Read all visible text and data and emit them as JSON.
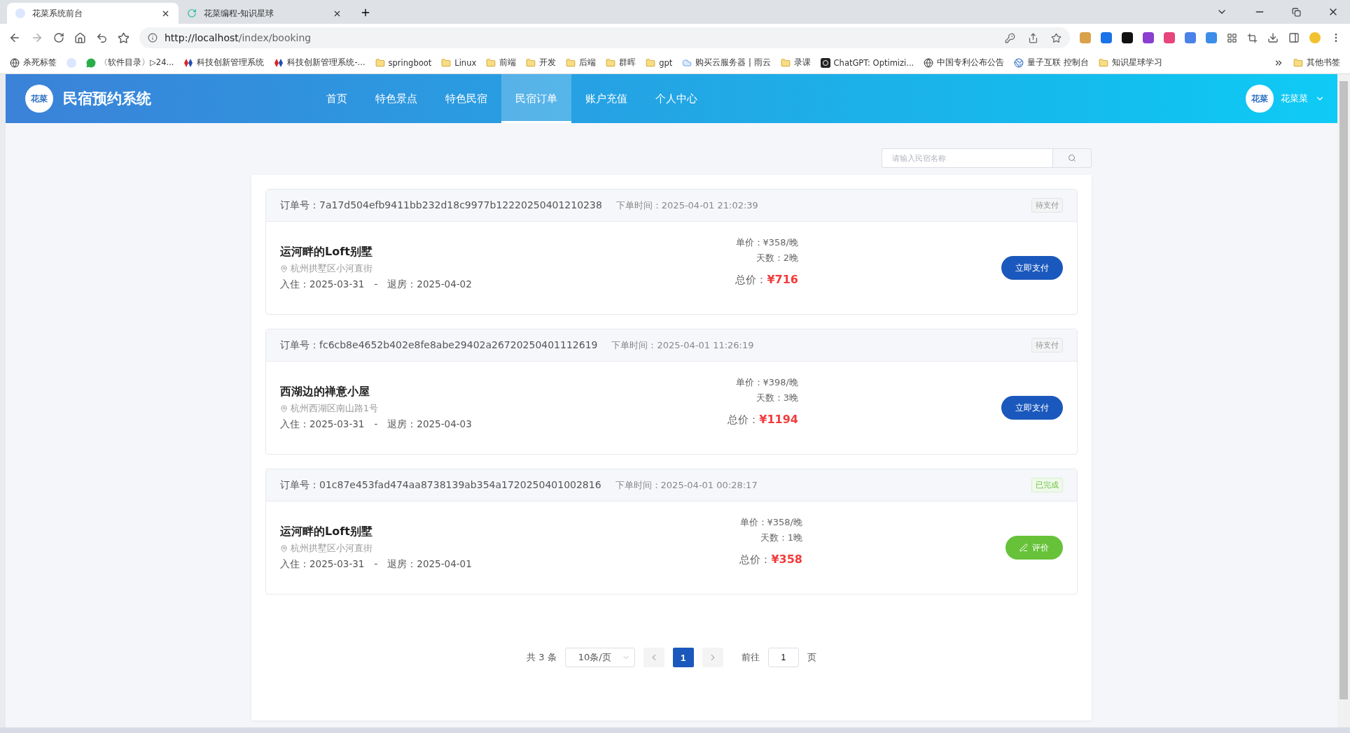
{
  "browser": {
    "tabs": [
      {
        "title": "花菜系统前台",
        "selected": true
      },
      {
        "title": "花菜编程-知识星球",
        "selected": false
      }
    ],
    "url_host": "http://localhost",
    "url_path": "/index/booking",
    "bookmarks": [
      {
        "label": "杀死标签",
        "kind": "globe"
      },
      {
        "kind": "logo"
      },
      {
        "label": "〈软件目录〉▷24...",
        "kind": "chat"
      },
      {
        "label": "科技创新管理系统",
        "kind": "diamond"
      },
      {
        "label": "科技创新管理系统-...",
        "kind": "diamond"
      },
      {
        "label": "springboot",
        "kind": "folder"
      },
      {
        "label": "Linux",
        "kind": "folder"
      },
      {
        "label": "前端",
        "kind": "folder"
      },
      {
        "label": "开发",
        "kind": "folder"
      },
      {
        "label": "后端",
        "kind": "folder"
      },
      {
        "label": "群晖",
        "kind": "folder"
      },
      {
        "label": "gpt",
        "kind": "folder"
      },
      {
        "label": "购买云服务器 | 雨云",
        "kind": "cloud"
      },
      {
        "label": "录课",
        "kind": "folder"
      },
      {
        "label": "ChatGPT: Optimizi...",
        "kind": "gpt"
      },
      {
        "label": "中国专利公布公告",
        "kind": "globe"
      },
      {
        "label": "量子互联 控制台",
        "kind": "earth"
      },
      {
        "label": "知识星球学习",
        "kind": "folder"
      }
    ],
    "other_bookmarks": "其他书签"
  },
  "app": {
    "logo_text": "花菜",
    "title": "民宿预约系统",
    "nav": [
      {
        "label": "首页",
        "selected": false
      },
      {
        "label": "特色景点",
        "selected": false
      },
      {
        "label": "特色民宿",
        "selected": false
      },
      {
        "label": "民宿订单",
        "selected": true
      },
      {
        "label": "账户充值",
        "selected": false
      },
      {
        "label": "个人中心",
        "selected": false
      }
    ],
    "user": {
      "avatar_text": "花菜",
      "name": "花菜菜"
    }
  },
  "search": {
    "placeholder": "请输入民宿名称"
  },
  "orders": [
    {
      "order_label": "订单号：",
      "order_no": "7a17d504efb9411bb232d18c9977b12220250401210238",
      "time_label": "下单时间：",
      "time": "2025-04-01 21:02:39",
      "status": "待支付",
      "kind": "pending",
      "name": "运河畔的Loft别墅",
      "address": "杭州拱墅区小河直街",
      "checkin": "入住：2025-03-31",
      "date_separator": "-",
      "checkout": "退房：2025-04-02",
      "unit_price": "单价：¥358/晚",
      "days": "天数：2晚",
      "total_label": "总价：",
      "total": "¥716",
      "action": "立即支付"
    },
    {
      "order_label": "订单号：",
      "order_no": "fc6cb8e4652b402e8fe8abe29402a26720250401112619",
      "time_label": "下单时间：",
      "time": "2025-04-01 11:26:19",
      "status": "待支付",
      "kind": "pending",
      "name": "西湖边的禅意小屋",
      "address": "杭州西湖区南山路1号",
      "checkin": "入住：2025-03-31",
      "date_separator": "-",
      "checkout": "退房：2025-04-03",
      "unit_price": "单价：¥398/晚",
      "days": "天数：3晚",
      "total_label": "总价：",
      "total": "¥1194",
      "action": "立即支付"
    },
    {
      "order_label": "订单号：",
      "order_no": "01c87e453fad474aa8738139ab354a1720250401002816",
      "time_label": "下单时间：",
      "time": "2025-04-01 00:28:17",
      "status": "已完成",
      "kind": "done",
      "name": "运河畔的Loft别墅",
      "address": "杭州拱墅区小河直街",
      "checkin": "入住：2025-03-31",
      "date_separator": "-",
      "checkout": "退房：2025-04-01",
      "unit_price": "单价：¥358/晚",
      "days": "天数：1晚",
      "total_label": "总价：",
      "total": "¥358",
      "action": "评价"
    }
  ],
  "pagination": {
    "total": "共 3 条",
    "page_size": "10条/页",
    "pages": [
      {
        "label": "1",
        "selected": true
      }
    ],
    "goto_label": "前往",
    "goto_value": "1",
    "goto_suffix": "页"
  }
}
